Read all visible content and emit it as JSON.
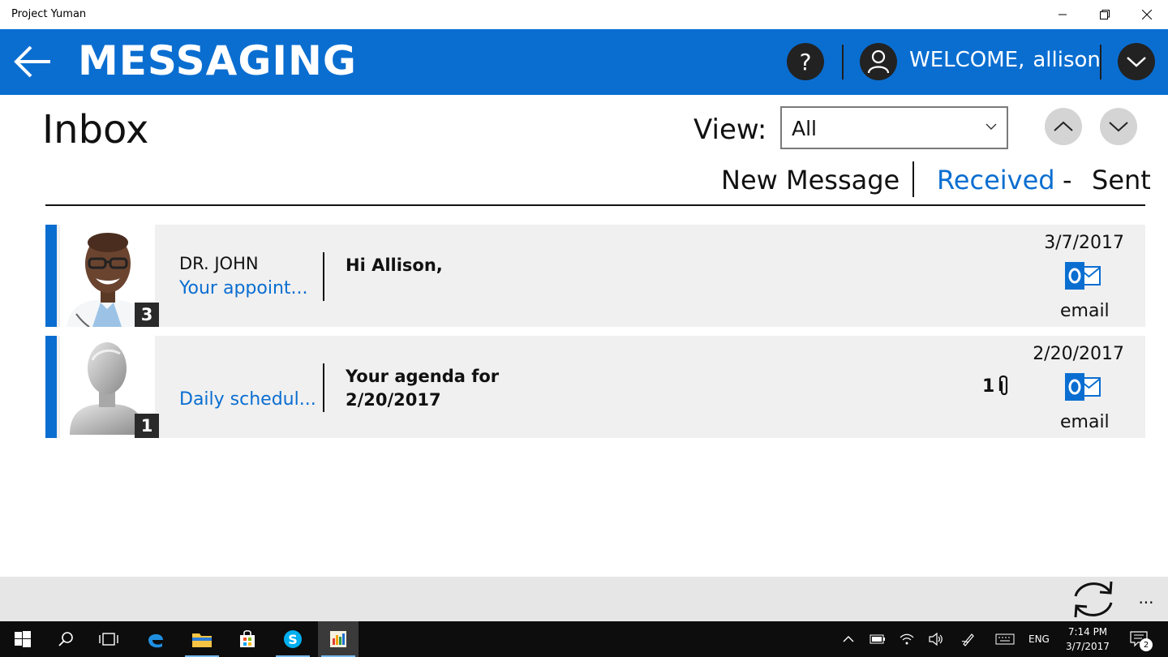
{
  "window": {
    "title": "Project Yuman"
  },
  "appbar": {
    "heading": "MESSAGING",
    "welcome_label": "WELCOME,",
    "username": "allison"
  },
  "inbox": {
    "title": "Inbox",
    "view_label": "View:",
    "view_value": "All",
    "tabs": {
      "new_message": "New Message",
      "received": "Received",
      "separator": "-",
      "sent": "Sent"
    }
  },
  "messages": [
    {
      "sender": "DR. JOHN",
      "subject": "Your appoint...",
      "preview_line1": "Hi Allison,",
      "preview_line2": "",
      "count": "3",
      "date": "3/7/2017",
      "channel": "email",
      "attachments": ""
    },
    {
      "sender": "",
      "subject": "Daily schedul...",
      "preview_line1": "Your agenda for",
      "preview_line2": "2/20/2017",
      "count": "1",
      "date": "2/20/2017",
      "channel": "email",
      "attachments": "1"
    }
  ],
  "cmdbar": {
    "more": "..."
  },
  "taskbar": {
    "language": "ENG",
    "time": "7:14 PM",
    "date": "3/7/2017",
    "notifications": "2"
  },
  "colors": {
    "accent": "#0a6ed1",
    "appbar": "#0a6ed1",
    "row_background": "#f0f0f0",
    "taskbar": "#0d0d0d"
  }
}
